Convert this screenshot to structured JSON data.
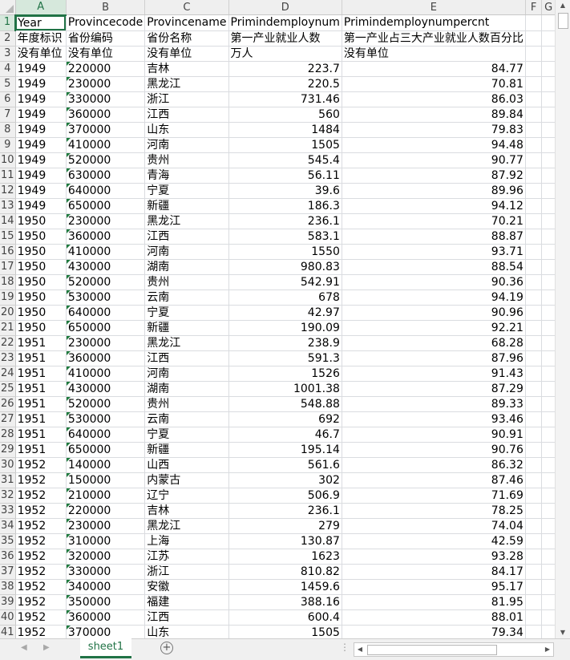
{
  "columns": [
    "A",
    "B",
    "C",
    "D",
    "E",
    "F",
    "G"
  ],
  "active_column": "A",
  "active_row": 1,
  "header_rows": [
    [
      "Year",
      "Provincecode",
      "Provincename",
      "Primindemploynum",
      "Primindemploynumpercnt"
    ],
    [
      "年度标识",
      "省份编码",
      "省份名称",
      "第一产业就业人数",
      "第一产业占三大产业就业人数百分比"
    ],
    [
      "没有单位",
      "没有单位",
      "没有单位",
      "万人",
      "没有单位"
    ]
  ],
  "data_rows": [
    [
      "1949",
      "220000",
      "吉林",
      "223.7",
      "84.77"
    ],
    [
      "1949",
      "230000",
      "黑龙江",
      "220.5",
      "70.81"
    ],
    [
      "1949",
      "330000",
      "浙江",
      "731.46",
      "86.03"
    ],
    [
      "1949",
      "360000",
      "江西",
      "560",
      "89.84"
    ],
    [
      "1949",
      "370000",
      "山东",
      "1484",
      "79.83"
    ],
    [
      "1949",
      "410000",
      "河南",
      "1505",
      "94.48"
    ],
    [
      "1949",
      "520000",
      "贵州",
      "545.4",
      "90.77"
    ],
    [
      "1949",
      "630000",
      "青海",
      "56.11",
      "87.92"
    ],
    [
      "1949",
      "640000",
      "宁夏",
      "39.6",
      "89.96"
    ],
    [
      "1949",
      "650000",
      "新疆",
      "186.3",
      "94.12"
    ],
    [
      "1950",
      "230000",
      "黑龙江",
      "236.1",
      "70.21"
    ],
    [
      "1950",
      "360000",
      "江西",
      "583.1",
      "88.87"
    ],
    [
      "1950",
      "410000",
      "河南",
      "1550",
      "93.71"
    ],
    [
      "1950",
      "430000",
      "湖南",
      "980.83",
      "88.54"
    ],
    [
      "1950",
      "520000",
      "贵州",
      "542.91",
      "90.36"
    ],
    [
      "1950",
      "530000",
      "云南",
      "678",
      "94.19"
    ],
    [
      "1950",
      "640000",
      "宁夏",
      "42.97",
      "90.96"
    ],
    [
      "1950",
      "650000",
      "新疆",
      "190.09",
      "92.21"
    ],
    [
      "1951",
      "230000",
      "黑龙江",
      "238.9",
      "68.28"
    ],
    [
      "1951",
      "360000",
      "江西",
      "591.3",
      "87.96"
    ],
    [
      "1951",
      "410000",
      "河南",
      "1526",
      "91.43"
    ],
    [
      "1951",
      "430000",
      "湖南",
      "1001.38",
      "87.29"
    ],
    [
      "1951",
      "520000",
      "贵州",
      "548.88",
      "89.33"
    ],
    [
      "1951",
      "530000",
      "云南",
      "692",
      "93.46"
    ],
    [
      "1951",
      "640000",
      "宁夏",
      "46.7",
      "90.91"
    ],
    [
      "1951",
      "650000",
      "新疆",
      "195.14",
      "90.76"
    ],
    [
      "1952",
      "140000",
      "山西",
      "561.6",
      "86.32"
    ],
    [
      "1952",
      "150000",
      "内蒙古",
      "302",
      "87.46"
    ],
    [
      "1952",
      "210000",
      "辽宁",
      "506.9",
      "71.69"
    ],
    [
      "1952",
      "220000",
      "吉林",
      "236.1",
      "78.25"
    ],
    [
      "1952",
      "230000",
      "黑龙江",
      "279",
      "74.04"
    ],
    [
      "1952",
      "310000",
      "上海",
      "130.87",
      "42.59"
    ],
    [
      "1952",
      "320000",
      "江苏",
      "1623",
      "93.28"
    ],
    [
      "1952",
      "330000",
      "浙江",
      "810.82",
      "84.17"
    ],
    [
      "1952",
      "340000",
      "安徽",
      "1459.6",
      "95.17"
    ],
    [
      "1952",
      "350000",
      "福建",
      "388.16",
      "81.95"
    ],
    [
      "1952",
      "360000",
      "江西",
      "600.4",
      "88.01"
    ],
    [
      "1952",
      "370000",
      "山东",
      "1505",
      "79.34"
    ]
  ],
  "sheet_tab": "sheet1",
  "add_sheet_symbol": "+",
  "scroll_dots": "⋮",
  "colors": {
    "accent": "#217346",
    "header_bg": "#efefef",
    "selected_header_bg": "#d6e8dc"
  },
  "icons": [
    "prev-sheet-icon",
    "next-sheet-icon",
    "add-sheet-icon",
    "scroll-up-icon",
    "scroll-down-icon",
    "scroll-left-icon",
    "scroll-right-icon"
  ]
}
